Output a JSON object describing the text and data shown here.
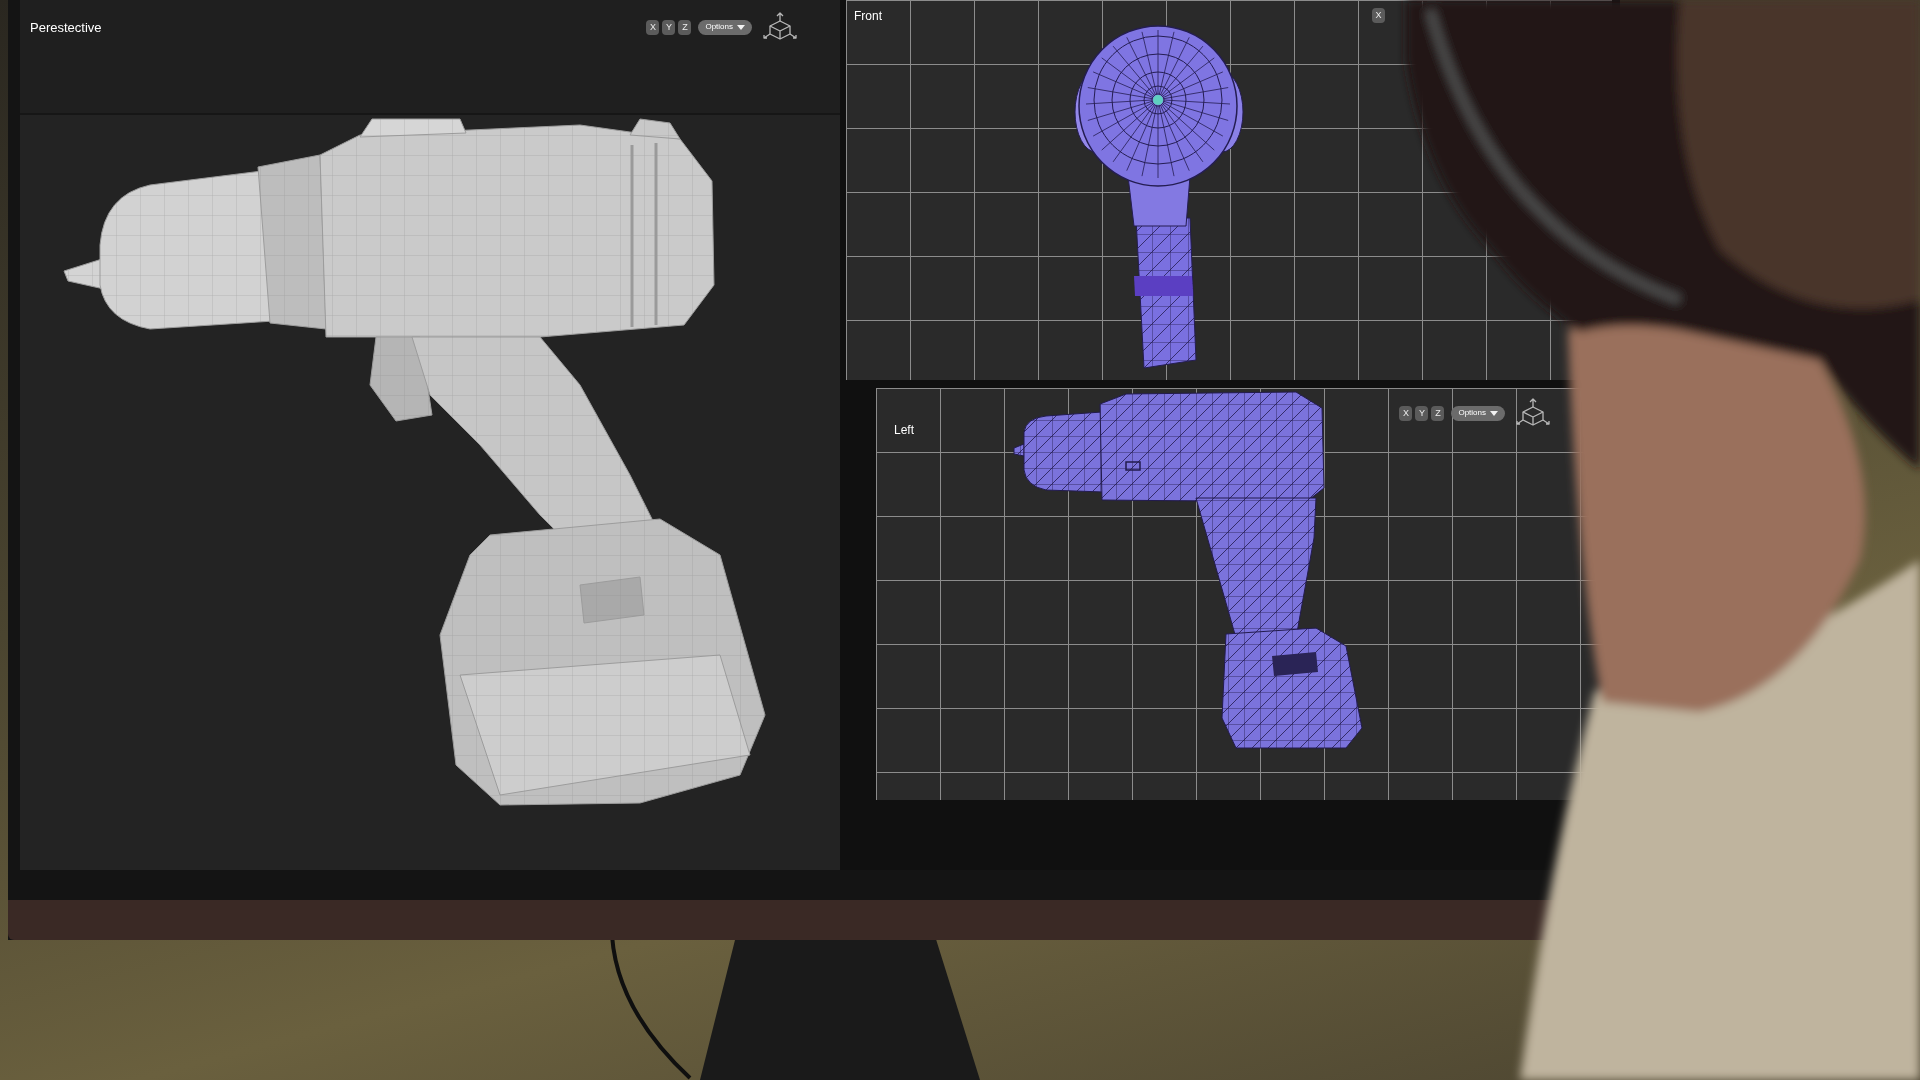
{
  "viewports": [
    {
      "kind": "shaded",
      "title": "Perestective",
      "axis_buttons": [
        "X",
        "Y",
        "Z"
      ],
      "options_label": "Options"
    },
    {
      "kind": "wireframe_front",
      "title": "Front",
      "axis_buttons": [
        "X"
      ]
    },
    {
      "kind": "wireframe_side",
      "title": "Left",
      "axis_buttons": [
        "X",
        "Y",
        "Z"
      ],
      "options_label": "Options"
    }
  ]
}
